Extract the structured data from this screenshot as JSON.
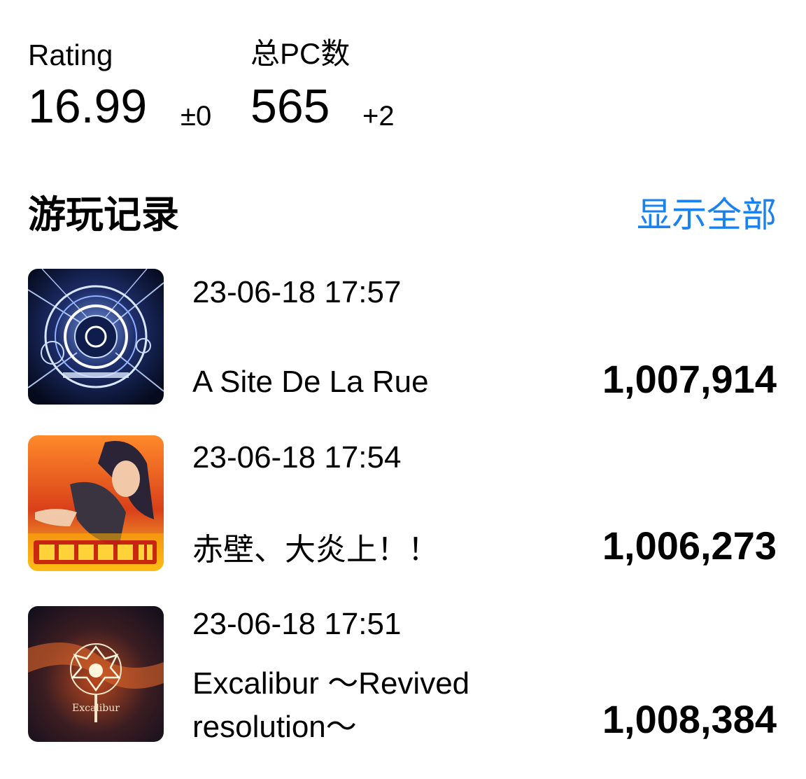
{
  "stats": {
    "rating": {
      "label": "Rating",
      "value": "16.99",
      "delta": "±0"
    },
    "pc": {
      "label": "总PC数",
      "value": "565",
      "delta": "+2"
    }
  },
  "records_section": {
    "title": "游玩记录",
    "show_all_label": "显示全部",
    "accent_color": "#1a82f0"
  },
  "records": [
    {
      "datetime": "23-06-18 17:57",
      "title": "A Site De La Rue",
      "score": "1,007,914",
      "cover_icon": "album-cover-blue-circle"
    },
    {
      "datetime": "23-06-18 17:54",
      "title": "赤壁、大炎上！！",
      "score": "1,006,273",
      "cover_icon": "album-cover-fire-warrior"
    },
    {
      "datetime": "23-06-18 17:51",
      "title": "Excalibur ～Revived resolution～",
      "score": "1,008,384",
      "cover_icon": "album-cover-excalibur-emblem"
    }
  ],
  "covers": {
    "excalibur_text": "Excalibur"
  }
}
